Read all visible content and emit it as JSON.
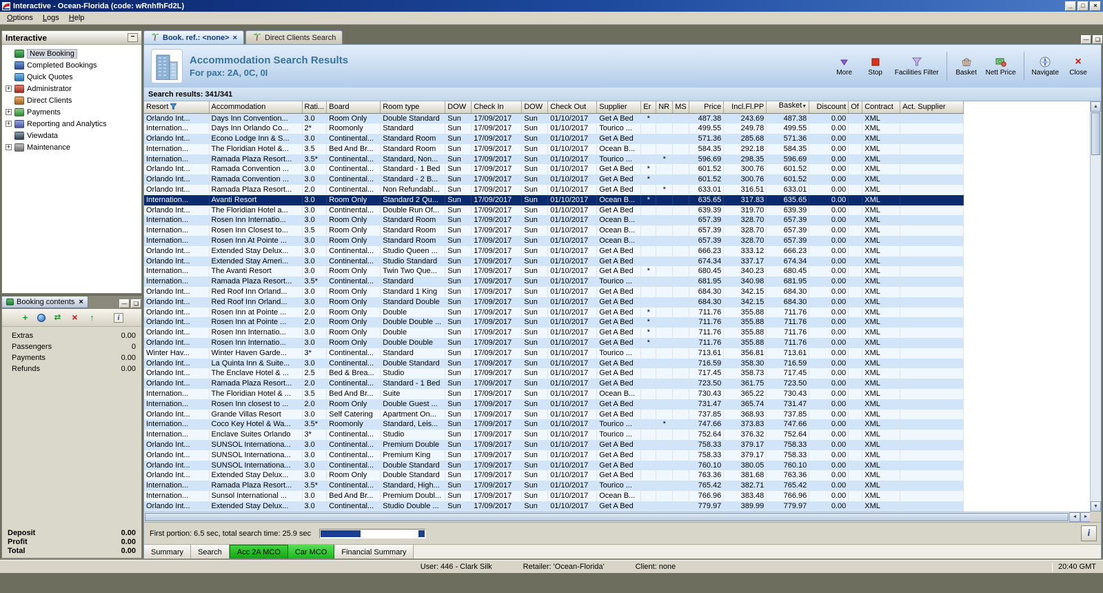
{
  "window": {
    "title": "Interactive - Ocean-Florida (code: wRnhfhFd2L)"
  },
  "menu": [
    "Options",
    "Logs",
    "Help"
  ],
  "sidebar": {
    "title": "Interactive",
    "items": [
      {
        "label": "New Booking",
        "expandable": false,
        "selected": true
      },
      {
        "label": "Completed Bookings",
        "expandable": false
      },
      {
        "label": "Quick Quotes",
        "expandable": false
      },
      {
        "label": "Administrator",
        "expandable": true
      },
      {
        "label": "Direct Clients",
        "expandable": false
      },
      {
        "label": "Payments",
        "expandable": true
      },
      {
        "label": "Reporting and Analytics",
        "expandable": true
      },
      {
        "label": "Viewdata",
        "expandable": false
      },
      {
        "label": "Maintenance",
        "expandable": true
      }
    ]
  },
  "booking_contents": {
    "title": "Booking contents",
    "rows": [
      {
        "label": "Extras",
        "value": "0.00"
      },
      {
        "label": "Passengers",
        "value": "0"
      },
      {
        "label": "Payments",
        "value": "0.00"
      },
      {
        "label": "Refunds",
        "value": "0.00"
      }
    ],
    "totals": [
      {
        "label": "Deposit",
        "value": "0.00"
      },
      {
        "label": "Profit",
        "value": "0.00"
      },
      {
        "label": "Total",
        "value": "0.00"
      }
    ]
  },
  "tabs": [
    {
      "label": "Book. ref.: <none>",
      "active": true,
      "closable": true
    },
    {
      "label": "Direct Clients Search",
      "active": false,
      "closable": false
    }
  ],
  "header": {
    "title": "Accommodation Search Results",
    "subtitle": "For pax: 2A, 0C, 0I"
  },
  "toolbar": {
    "groups": [
      [
        {
          "icon": "more",
          "label": "More"
        },
        {
          "icon": "stop",
          "label": "Stop"
        },
        {
          "icon": "filter",
          "label": "Facilities Filter"
        }
      ],
      [
        {
          "icon": "basket",
          "label": "Basket"
        },
        {
          "icon": "nett",
          "label": "Nett Price"
        }
      ],
      [
        {
          "icon": "navigate",
          "label": "Navigate"
        },
        {
          "icon": "close",
          "label": "Close"
        }
      ]
    ]
  },
  "results": {
    "count_label": "Search results: 341/341"
  },
  "table": {
    "columns": [
      {
        "label": "Resort",
        "filter": true
      },
      {
        "label": "Accommodation"
      },
      {
        "label": "Rati..."
      },
      {
        "label": "Board"
      },
      {
        "label": "Room type"
      },
      {
        "label": "DOW"
      },
      {
        "label": "Check In"
      },
      {
        "label": "DOW"
      },
      {
        "label": "Check Out"
      },
      {
        "label": "Supplier"
      },
      {
        "label": "Er"
      },
      {
        "label": "NR"
      },
      {
        "label": "MS"
      },
      {
        "label": "Price",
        "align": "right"
      },
      {
        "label": "Incl.Fl.PP",
        "align": "right"
      },
      {
        "label": "Basket",
        "align": "right",
        "sort": true
      },
      {
        "label": "Discount",
        "align": "right"
      },
      {
        "label": "Of"
      },
      {
        "label": "Contract"
      },
      {
        "label": "Act. Supplier"
      }
    ],
    "selected_index": 8,
    "rows": [
      [
        "Orlando Int...",
        "Days Inn Convention...",
        "3.0",
        "Room Only",
        "Double Standard",
        "Sun",
        "17/09/2017",
        "Sun",
        "01/10/2017",
        "Get A Bed",
        "*",
        "",
        "",
        "487.38",
        "243.69",
        "487.38",
        "0.00",
        "",
        "XML",
        ""
      ],
      [
        "Internation...",
        "Days Inn Orlando Co...",
        "2*",
        "Roomonly",
        "Standard",
        "Sun",
        "17/09/2017",
        "Sun",
        "01/10/2017",
        "Tourico ...",
        "",
        "",
        "",
        "499.55",
        "249.78",
        "499.55",
        "0.00",
        "",
        "XML",
        ""
      ],
      [
        "Orlando Int...",
        "Econo Lodge Inn & S...",
        "3.0",
        "Continental...",
        "Standard Room",
        "Sun",
        "17/09/2017",
        "Sun",
        "01/10/2017",
        "Get A Bed",
        "",
        "",
        "",
        "571.36",
        "285.68",
        "571.36",
        "0.00",
        "",
        "XML",
        ""
      ],
      [
        "Internation...",
        "The Floridian Hotel &...",
        "3.5",
        "Bed And Br...",
        "Standard Room",
        "Sun",
        "17/09/2017",
        "Sun",
        "01/10/2017",
        "Ocean B...",
        "",
        "",
        "",
        "584.35",
        "292.18",
        "584.35",
        "0.00",
        "",
        "XML",
        ""
      ],
      [
        "Internation...",
        "Ramada Plaza Resort...",
        "3.5*",
        "Continental...",
        "Standard, Non...",
        "Sun",
        "17/09/2017",
        "Sun",
        "01/10/2017",
        "Tourico ...",
        "",
        "*",
        "",
        "596.69",
        "298.35",
        "596.69",
        "0.00",
        "",
        "XML",
        ""
      ],
      [
        "Orlando Int...",
        "Ramada Convention ...",
        "3.0",
        "Continental...",
        "Standard - 1 Bed",
        "Sun",
        "17/09/2017",
        "Sun",
        "01/10/2017",
        "Get A Bed",
        "*",
        "",
        "",
        "601.52",
        "300.76",
        "601.52",
        "0.00",
        "",
        "XML",
        ""
      ],
      [
        "Orlando Int...",
        "Ramada Convention ...",
        "3.0",
        "Continental...",
        "Standard - 2 B...",
        "Sun",
        "17/09/2017",
        "Sun",
        "01/10/2017",
        "Get A Bed",
        "*",
        "",
        "",
        "601.52",
        "300.76",
        "601.52",
        "0.00",
        "",
        "XML",
        ""
      ],
      [
        "Orlando Int...",
        "Ramada Plaza Resort...",
        "2.0",
        "Continental...",
        "Non Refundabl...",
        "Sun",
        "17/09/2017",
        "Sun",
        "01/10/2017",
        "Get A Bed",
        "",
        "*",
        "",
        "633.01",
        "316.51",
        "633.01",
        "0.00",
        "",
        "XML",
        ""
      ],
      [
        "Internation...",
        "Avanti Resort",
        "3.0",
        "Room Only",
        "Standard 2 Qu...",
        "Sun",
        "17/09/2017",
        "Sun",
        "01/10/2017",
        "Ocean B...",
        "*",
        "",
        "",
        "635.65",
        "317.83",
        "635.65",
        "0.00",
        "",
        "XML",
        ""
      ],
      [
        "Orlando Int...",
        "The Floridian Hotel a...",
        "3.0",
        "Continental...",
        "Double Run Of...",
        "Sun",
        "17/09/2017",
        "Sun",
        "01/10/2017",
        "Get A Bed",
        "",
        "",
        "",
        "639.39",
        "319.70",
        "639.39",
        "0.00",
        "",
        "XML",
        ""
      ],
      [
        "Internation...",
        "Rosen Inn Internatio...",
        "3.0",
        "Room Only",
        "Standard Room",
        "Sun",
        "17/09/2017",
        "Sun",
        "01/10/2017",
        "Ocean B...",
        "",
        "",
        "",
        "657.39",
        "328.70",
        "657.39",
        "0.00",
        "",
        "XML",
        ""
      ],
      [
        "Internation...",
        "Rosen Inn Closest to...",
        "3.5",
        "Room Only",
        "Standard Room",
        "Sun",
        "17/09/2017",
        "Sun",
        "01/10/2017",
        "Ocean B...",
        "",
        "",
        "",
        "657.39",
        "328.70",
        "657.39",
        "0.00",
        "",
        "XML",
        ""
      ],
      [
        "Internation...",
        "Rosen Inn At Pointe ...",
        "3.0",
        "Room Only",
        "Standard Room",
        "Sun",
        "17/09/2017",
        "Sun",
        "01/10/2017",
        "Ocean B...",
        "",
        "",
        "",
        "657.39",
        "328.70",
        "657.39",
        "0.00",
        "",
        "XML",
        ""
      ],
      [
        "Orlando Int...",
        "Extended Stay Delux...",
        "3.0",
        "Continental...",
        "Studio Queen ...",
        "Sun",
        "17/09/2017",
        "Sun",
        "01/10/2017",
        "Get A Bed",
        "",
        "",
        "",
        "666.23",
        "333.12",
        "666.23",
        "0.00",
        "",
        "XML",
        ""
      ],
      [
        "Orlando Int...",
        "Extended Stay Ameri...",
        "3.0",
        "Continental...",
        "Studio Standard",
        "Sun",
        "17/09/2017",
        "Sun",
        "01/10/2017",
        "Get A Bed",
        "",
        "",
        "",
        "674.34",
        "337.17",
        "674.34",
        "0.00",
        "",
        "XML",
        ""
      ],
      [
        "Internation...",
        "The Avanti Resort",
        "3.0",
        "Room Only",
        "Twin Two Que...",
        "Sun",
        "17/09/2017",
        "Sun",
        "01/10/2017",
        "Get A Bed",
        "*",
        "",
        "",
        "680.45",
        "340.23",
        "680.45",
        "0.00",
        "",
        "XML",
        ""
      ],
      [
        "Internation...",
        "Ramada Plaza Resort...",
        "3.5*",
        "Continental...",
        "Standard",
        "Sun",
        "17/09/2017",
        "Sun",
        "01/10/2017",
        "Tourico ...",
        "",
        "",
        "",
        "681.95",
        "340.98",
        "681.95",
        "0.00",
        "",
        "XML",
        ""
      ],
      [
        "Orlando Int...",
        "Red Roof Inn Orland...",
        "3.0",
        "Room Only",
        "Standard 1 King",
        "Sun",
        "17/09/2017",
        "Sun",
        "01/10/2017",
        "Get A Bed",
        "",
        "",
        "",
        "684.30",
        "342.15",
        "684.30",
        "0.00",
        "",
        "XML",
        ""
      ],
      [
        "Orlando Int...",
        "Red Roof Inn Orland...",
        "3.0",
        "Room Only",
        "Standard Double",
        "Sun",
        "17/09/2017",
        "Sun",
        "01/10/2017",
        "Get A Bed",
        "",
        "",
        "",
        "684.30",
        "342.15",
        "684.30",
        "0.00",
        "",
        "XML",
        ""
      ],
      [
        "Orlando Int...",
        "Rosen Inn at Pointe ...",
        "2.0",
        "Room Only",
        "Double",
        "Sun",
        "17/09/2017",
        "Sun",
        "01/10/2017",
        "Get A Bed",
        "*",
        "",
        "",
        "711.76",
        "355.88",
        "711.76",
        "0.00",
        "",
        "XML",
        ""
      ],
      [
        "Orlando Int...",
        "Rosen Inn at Pointe ...",
        "2.0",
        "Room Only",
        "Double Double ...",
        "Sun",
        "17/09/2017",
        "Sun",
        "01/10/2017",
        "Get A Bed",
        "*",
        "",
        "",
        "711.76",
        "355.88",
        "711.76",
        "0.00",
        "",
        "XML",
        ""
      ],
      [
        "Orlando Int...",
        "Rosen Inn Internatio...",
        "3.0",
        "Room Only",
        "Double",
        "Sun",
        "17/09/2017",
        "Sun",
        "01/10/2017",
        "Get A Bed",
        "*",
        "",
        "",
        "711.76",
        "355.88",
        "711.76",
        "0.00",
        "",
        "XML",
        ""
      ],
      [
        "Orlando Int...",
        "Rosen Inn Internatio...",
        "3.0",
        "Room Only",
        "Double Double",
        "Sun",
        "17/09/2017",
        "Sun",
        "01/10/2017",
        "Get A Bed",
        "*",
        "",
        "",
        "711.76",
        "355.88",
        "711.76",
        "0.00",
        "",
        "XML",
        ""
      ],
      [
        "Winter Hav...",
        "Winter Haven Garde...",
        "3*",
        "Continental...",
        "Standard",
        "Sun",
        "17/09/2017",
        "Sun",
        "01/10/2017",
        "Tourico ...",
        "",
        "",
        "",
        "713.61",
        "356.81",
        "713.61",
        "0.00",
        "",
        "XML",
        ""
      ],
      [
        "Orlando Int...",
        "La Quinta Inn & Suite...",
        "3.0",
        "Continental...",
        "Double Standard",
        "Sun",
        "17/09/2017",
        "Sun",
        "01/10/2017",
        "Get A Bed",
        "",
        "",
        "",
        "716.59",
        "358.30",
        "716.59",
        "0.00",
        "",
        "XML",
        ""
      ],
      [
        "Orlando Int...",
        "The Enclave Hotel & ...",
        "2.5",
        "Bed & Brea...",
        "Studio",
        "Sun",
        "17/09/2017",
        "Sun",
        "01/10/2017",
        "Get A Bed",
        "",
        "",
        "",
        "717.45",
        "358.73",
        "717.45",
        "0.00",
        "",
        "XML",
        ""
      ],
      [
        "Orlando Int...",
        "Ramada Plaza Resort...",
        "2.0",
        "Continental...",
        "Standard - 1 Bed",
        "Sun",
        "17/09/2017",
        "Sun",
        "01/10/2017",
        "Get A Bed",
        "",
        "",
        "",
        "723.50",
        "361.75",
        "723.50",
        "0.00",
        "",
        "XML",
        ""
      ],
      [
        "Internation...",
        "The Floridian Hotel & ...",
        "3.5",
        "Bed And Br...",
        "Suite",
        "Sun",
        "17/09/2017",
        "Sun",
        "01/10/2017",
        "Ocean B...",
        "",
        "",
        "",
        "730.43",
        "365.22",
        "730.43",
        "0.00",
        "",
        "XML",
        ""
      ],
      [
        "Internation...",
        "Rosen Inn closest to ...",
        "2.0",
        "Room Only",
        "Double Guest ...",
        "Sun",
        "17/09/2017",
        "Sun",
        "01/10/2017",
        "Get A Bed",
        "",
        "",
        "",
        "731.47",
        "365.74",
        "731.47",
        "0.00",
        "",
        "XML",
        ""
      ],
      [
        "Orlando Int...",
        "Grande Villas Resort",
        "3.0",
        "Self Catering",
        "Apartment On...",
        "Sun",
        "17/09/2017",
        "Sun",
        "01/10/2017",
        "Get A Bed",
        "",
        "",
        "",
        "737.85",
        "368.93",
        "737.85",
        "0.00",
        "",
        "XML",
        ""
      ],
      [
        "Internation...",
        "Coco Key Hotel & Wa...",
        "3.5*",
        "Roomonly",
        "Standard, Leis...",
        "Sun",
        "17/09/2017",
        "Sun",
        "01/10/2017",
        "Tourico ...",
        "",
        "*",
        "",
        "747.66",
        "373.83",
        "747.66",
        "0.00",
        "",
        "XML",
        ""
      ],
      [
        "Internation...",
        "Enclave Suites Orlando",
        "3*",
        "Continental...",
        "Studio",
        "Sun",
        "17/09/2017",
        "Sun",
        "01/10/2017",
        "Tourico ...",
        "",
        "",
        "",
        "752.64",
        "376.32",
        "752.64",
        "0.00",
        "",
        "XML",
        ""
      ],
      [
        "Orlando Int...",
        "SUNSOL Internationa...",
        "3.0",
        "Continental...",
        "Premium Double",
        "Sun",
        "17/09/2017",
        "Sun",
        "01/10/2017",
        "Get A Bed",
        "",
        "",
        "",
        "758.33",
        "379.17",
        "758.33",
        "0.00",
        "",
        "XML",
        ""
      ],
      [
        "Orlando Int...",
        "SUNSOL Internationa...",
        "3.0",
        "Continental...",
        "Premium King",
        "Sun",
        "17/09/2017",
        "Sun",
        "01/10/2017",
        "Get A Bed",
        "",
        "",
        "",
        "758.33",
        "379.17",
        "758.33",
        "0.00",
        "",
        "XML",
        ""
      ],
      [
        "Orlando Int...",
        "SUNSOL Internationa...",
        "3.0",
        "Continental...",
        "Double Standard",
        "Sun",
        "17/09/2017",
        "Sun",
        "01/10/2017",
        "Get A Bed",
        "",
        "",
        "",
        "760.10",
        "380.05",
        "760.10",
        "0.00",
        "",
        "XML",
        ""
      ],
      [
        "Orlando Int...",
        "Extended Stay Delux...",
        "3.0",
        "Room Only",
        "Double Standard",
        "Sun",
        "17/09/2017",
        "Sun",
        "01/10/2017",
        "Get A Bed",
        "",
        "",
        "",
        "763.36",
        "381.68",
        "763.36",
        "0.00",
        "",
        "XML",
        ""
      ],
      [
        "Internation...",
        "Ramada Plaza Resort...",
        "3.5*",
        "Continental...",
        "Standard, High...",
        "Sun",
        "17/09/2017",
        "Sun",
        "01/10/2017",
        "Tourico ...",
        "",
        "",
        "",
        "765.42",
        "382.71",
        "765.42",
        "0.00",
        "",
        "XML",
        ""
      ],
      [
        "Internation...",
        "Sunsol International ...",
        "3.0",
        "Bed And Br...",
        "Premium Doubl...",
        "Sun",
        "17/09/2017",
        "Sun",
        "01/10/2017",
        "Ocean B...",
        "",
        "",
        "",
        "766.96",
        "383.48",
        "766.96",
        "0.00",
        "",
        "XML",
        ""
      ],
      [
        "Orlando Int...",
        "Extended Stay Delux...",
        "3.0",
        "Continental...",
        "Studio Double ...",
        "Sun",
        "17/09/2017",
        "Sun",
        "01/10/2017",
        "Get A Bed",
        "",
        "",
        "",
        "779.97",
        "389.99",
        "779.97",
        "0.00",
        "",
        "XML",
        ""
      ]
    ]
  },
  "status": {
    "text": "First portion: 6.5 sec, total search time: 25.9 sec",
    "progress_percent": 38
  },
  "bottom_tabs": [
    {
      "label": "Summary",
      "style": "plain"
    },
    {
      "label": "Search",
      "style": "plain"
    },
    {
      "label": "Acc 2A MCO",
      "style": "green",
      "active": true
    },
    {
      "label": "Car MCO",
      "style": "green"
    },
    {
      "label": "Financial Summary",
      "style": "plain"
    }
  ],
  "status_bar": {
    "user": "User: 446 - Clark Silk",
    "retailer": "Retailer: 'Ocean-Florida'",
    "client": "Client: none",
    "time": "20:40 GMT"
  }
}
